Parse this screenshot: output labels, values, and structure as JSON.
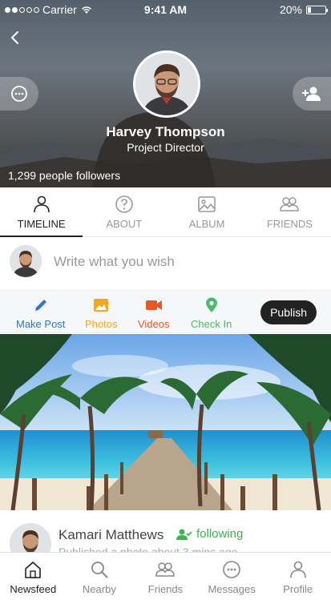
{
  "status_bar": {
    "carrier": "Carrier",
    "time": "9:41 AM",
    "battery": "20%",
    "battery_level": 0.2
  },
  "profile": {
    "name": "Harvey Thompson",
    "role": "Project Director",
    "followers": "1,299 people followers"
  },
  "tabs": [
    {
      "label": "TIMELINE",
      "icon": "person-icon",
      "active": true
    },
    {
      "label": "ABOUT",
      "icon": "question-icon"
    },
    {
      "label": "ALBUM",
      "icon": "image-icon"
    },
    {
      "label": "FRIENDS",
      "icon": "group-icon"
    }
  ],
  "composer": {
    "placeholder": "Write what you wish"
  },
  "actions": [
    {
      "label": "Make Post",
      "icon": "pencil-icon",
      "color": "#2b77c8"
    },
    {
      "label": "Photos",
      "icon": "photo-icon",
      "color": "#f5a623"
    },
    {
      "label": "Videos",
      "icon": "video-icon",
      "color": "#e8562a"
    },
    {
      "label": "Check In",
      "icon": "location-pin-icon",
      "color": "#4cb86a"
    }
  ],
  "publish_label": "Publish",
  "post": {
    "author": "Kamari Matthews",
    "follow_status": "following",
    "subtitle": "Published a photo about 3 mins ago"
  },
  "bottom_nav": [
    {
      "label": "Newsfeed",
      "icon": "home-icon",
      "active": true
    },
    {
      "label": "Nearby",
      "icon": "search-icon"
    },
    {
      "label": "Friends",
      "icon": "friends-icon"
    },
    {
      "label": "Messages",
      "icon": "chat-bubble-icon"
    },
    {
      "label": "Profile",
      "icon": "profile-icon"
    }
  ],
  "colors": {
    "accent_dark": "#222222",
    "following_green": "#3cb54a"
  }
}
